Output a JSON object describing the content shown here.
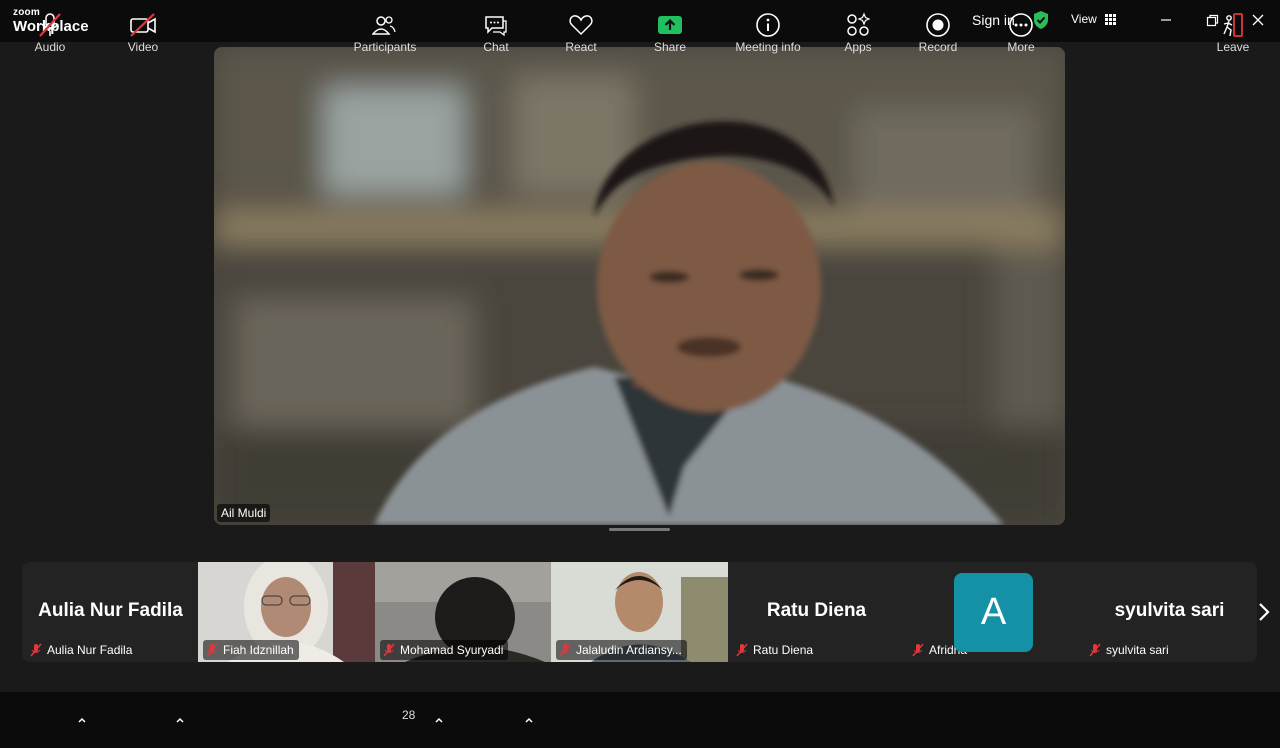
{
  "app": {
    "logo_small": "zoom",
    "logo_big": "Workplace"
  },
  "titlebar": {
    "signin": "Sign in",
    "view": "View"
  },
  "main_video": {
    "speaker_name": "Ail Muldi"
  },
  "gallery": [
    {
      "display": "Aulia Nur Fadila",
      "label": "Aulia Nur Fadila",
      "type": "name"
    },
    {
      "display": "",
      "label": "Fiah Idznillah",
      "type": "video"
    },
    {
      "display": "",
      "label": "Mohamad Syuryadi",
      "type": "video"
    },
    {
      "display": "",
      "label": "Jalaludin Ardiansy...",
      "type": "video"
    },
    {
      "display": "Ratu Diena",
      "label": "Ratu Diena",
      "type": "name"
    },
    {
      "display": "A",
      "label": "Afridha",
      "type": "avatar"
    },
    {
      "display": "syulvita sari",
      "label": "syulvita sari",
      "type": "name"
    }
  ],
  "toolbar": {
    "audio": "Audio",
    "video": "Video",
    "participants": "Participants",
    "participants_count": "28",
    "chat": "Chat",
    "react": "React",
    "share": "Share",
    "meeting_info": "Meeting info",
    "apps": "Apps",
    "record": "Record",
    "more": "More",
    "leave": "Leave"
  },
  "colors": {
    "share_green": "#20c060",
    "shield_green": "#2dbd58",
    "muted_red": "#e0383e",
    "avatar_teal": "#1591a5"
  },
  "icons": [
    "shield-check-icon",
    "grid-icon",
    "minimize-icon",
    "restore-icon",
    "close-icon",
    "mic-muted-icon",
    "video-off-icon",
    "participants-icon",
    "chat-icon",
    "heart-icon",
    "share-arrow-icon",
    "info-icon",
    "apps-icon",
    "record-icon",
    "more-icon",
    "leave-icon"
  ]
}
